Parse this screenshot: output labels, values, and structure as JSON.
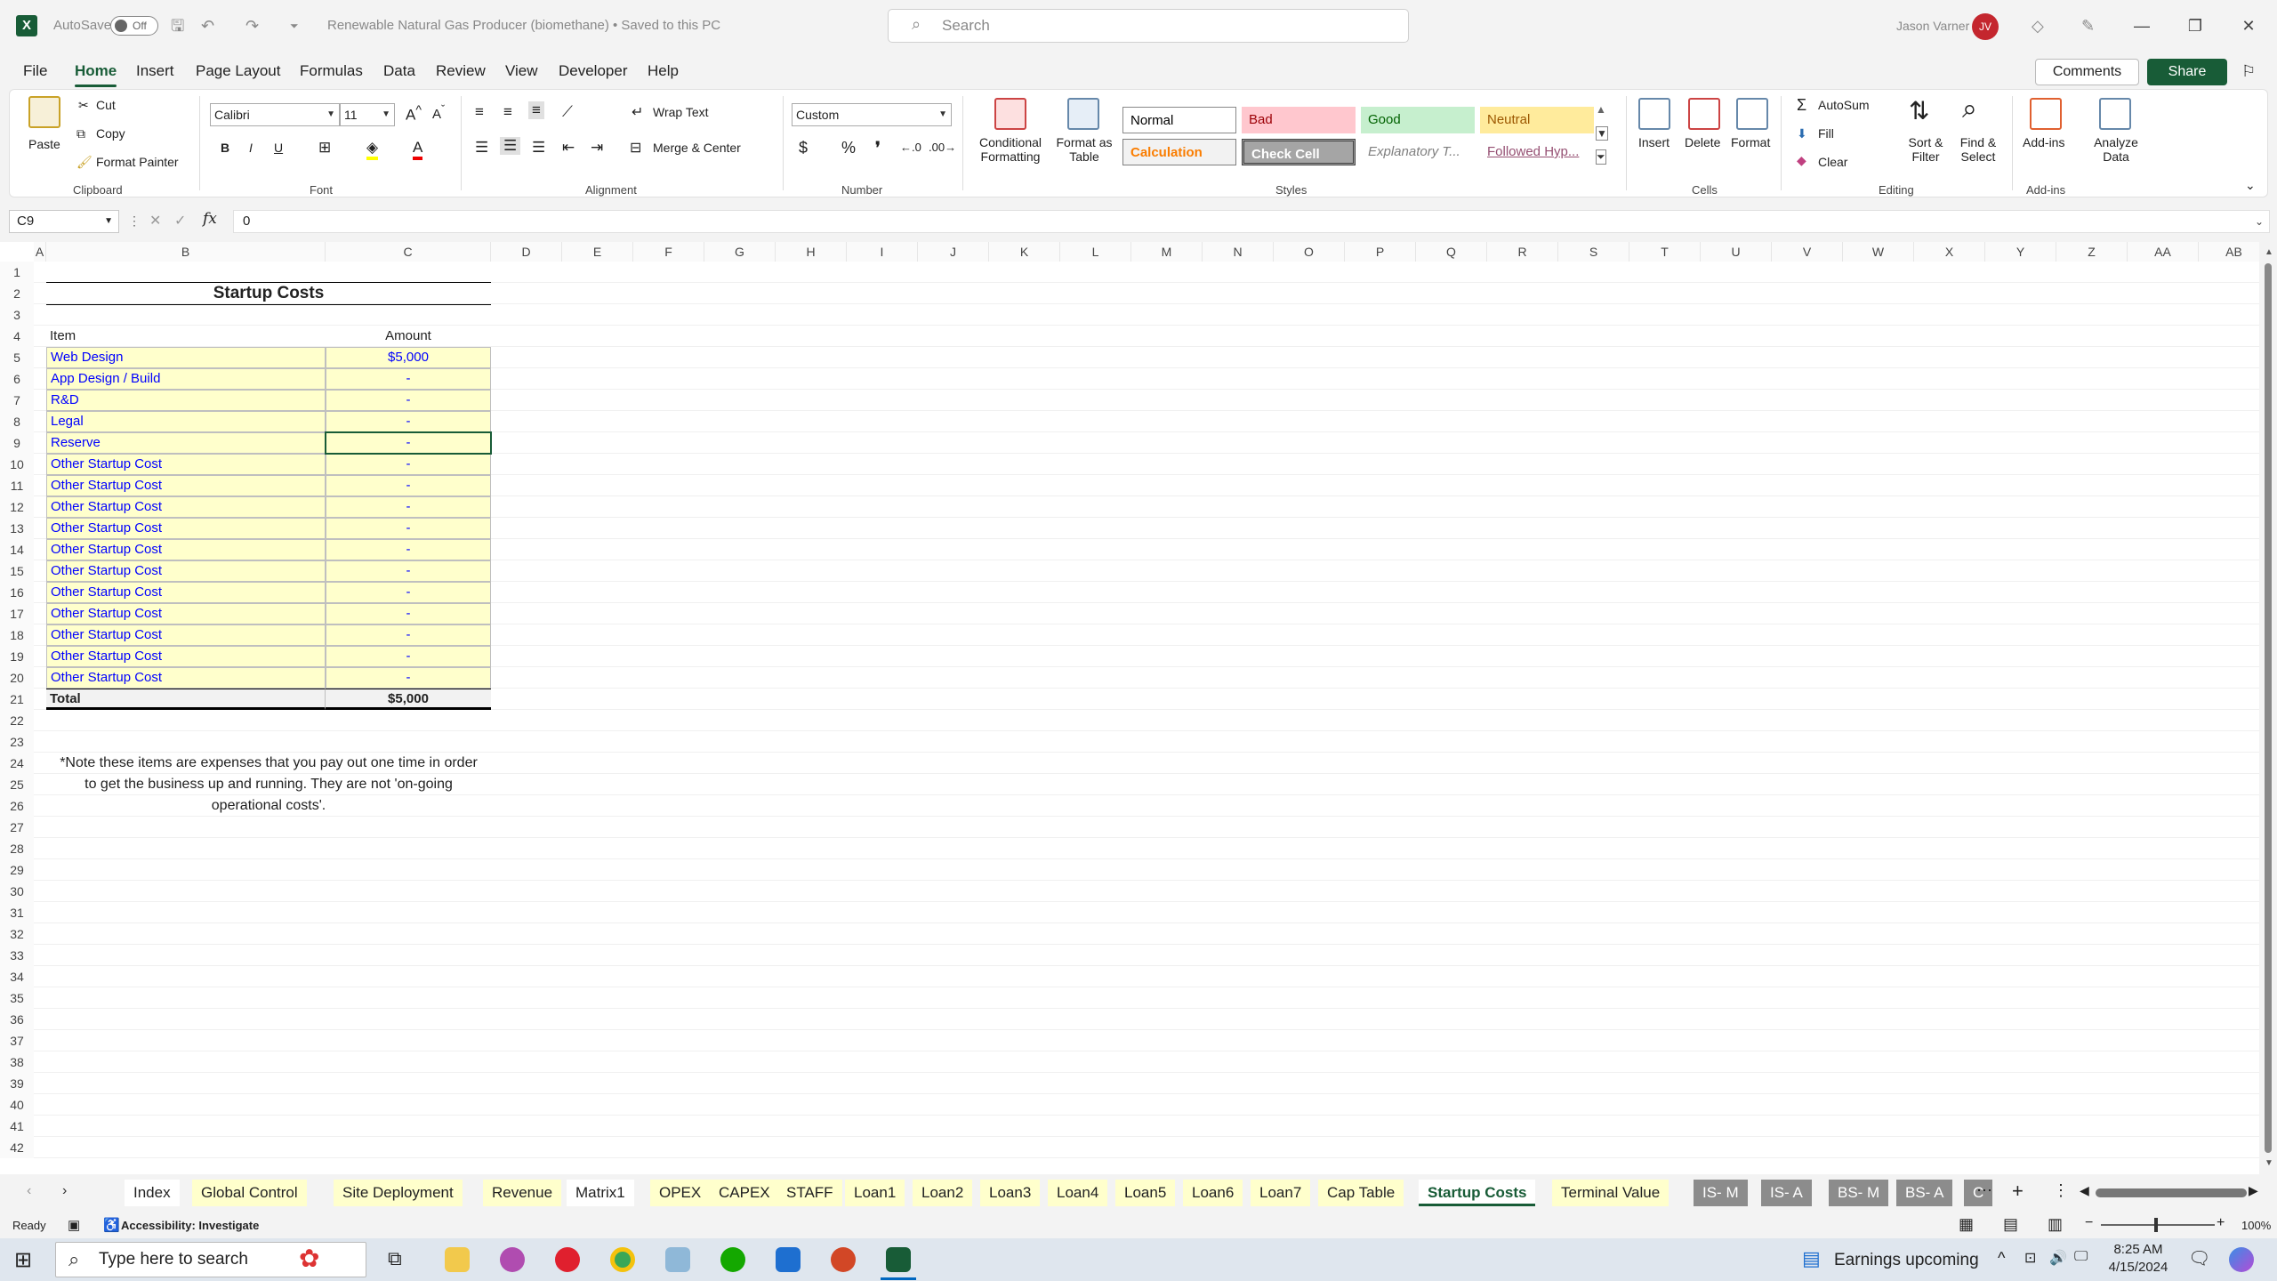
{
  "titlebar": {
    "autosave_label": "AutoSave",
    "autosave_state": "Off",
    "doc_title": "Renewable Natural Gas Producer (biomethane) • Saved to this PC",
    "search_placeholder": "Search",
    "user_name": "Jason Varner",
    "user_initials": "JV"
  },
  "menu": [
    "File",
    "Home",
    "Insert",
    "Page Layout",
    "Formulas",
    "Data",
    "Review",
    "View",
    "Developer",
    "Help"
  ],
  "menu_active": "Home",
  "menu_right": {
    "comments": "Comments",
    "share": "Share"
  },
  "ribbon": {
    "clipboard": {
      "paste": "Paste",
      "cut": "Cut",
      "copy": "Copy",
      "format_painter": "Format Painter",
      "group": "Clipboard"
    },
    "font": {
      "name": "Calibri",
      "size": "11",
      "bold": "B",
      "italic": "I",
      "underline": "U",
      "group": "Font"
    },
    "alignment": {
      "wrap_text": "Wrap Text",
      "merge_center": "Merge & Center",
      "group": "Alignment"
    },
    "number": {
      "format": "Custom",
      "currency": "$",
      "percent": "%",
      "group": "Number"
    },
    "styles": {
      "conditional": "Conditional Formatting",
      "format_table": "Format as Table",
      "normal": "Normal",
      "bad": "Bad",
      "good": "Good",
      "neutral": "Neutral",
      "calculation": "Calculation",
      "check_cell": "Check Cell",
      "explanatory": "Explanatory T...",
      "followed": "Followed Hyp...",
      "group": "Styles"
    },
    "cells": {
      "insert": "Insert",
      "delete": "Delete",
      "format": "Format",
      "group": "Cells"
    },
    "editing": {
      "autosum": "AutoSum",
      "fill": "Fill",
      "clear": "Clear",
      "sort_filter": "Sort & Filter",
      "find_select": "Find & Select",
      "group": "Editing"
    },
    "addins": {
      "addins": "Add-ins",
      "analyze": "Analyze Data",
      "group": "Add-ins"
    }
  },
  "formula_bar": {
    "name_box": "C9",
    "fx": "fx",
    "value": "0"
  },
  "columns": [
    "A",
    "B",
    "C",
    "D",
    "E",
    "F",
    "G",
    "H",
    "I",
    "J",
    "K",
    "L",
    "M",
    "N",
    "O",
    "P",
    "Q",
    "R",
    "S",
    "T",
    "U",
    "V",
    "W",
    "X",
    "Y",
    "Z",
    "AA",
    "AB"
  ],
  "rows": [
    "1",
    "2",
    "3",
    "4",
    "5",
    "6",
    "7",
    "8",
    "9",
    "10",
    "11",
    "12",
    "13",
    "14",
    "15",
    "16",
    "17",
    "18",
    "19",
    "20",
    "21",
    "22",
    "23",
    "24",
    "25",
    "26",
    "27",
    "28",
    "29",
    "30",
    "31",
    "32",
    "33",
    "34",
    "35",
    "36",
    "37",
    "38",
    "39",
    "40",
    "41",
    "42"
  ],
  "sheet": {
    "title": "Startup Costs",
    "header_item": "Item",
    "header_amount": "Amount",
    "items": [
      {
        "item": "Web Design",
        "amount": "$5,000"
      },
      {
        "item": "App Design / Build",
        "amount": "-"
      },
      {
        "item": "R&D",
        "amount": "-"
      },
      {
        "item": "Legal",
        "amount": "-"
      },
      {
        "item": "Reserve",
        "amount": "-"
      },
      {
        "item": "Other Startup Cost",
        "amount": "-"
      },
      {
        "item": "Other Startup Cost",
        "amount": "-"
      },
      {
        "item": "Other Startup Cost",
        "amount": "-"
      },
      {
        "item": "Other Startup Cost",
        "amount": "-"
      },
      {
        "item": "Other Startup Cost",
        "amount": "-"
      },
      {
        "item": "Other Startup Cost",
        "amount": "-"
      },
      {
        "item": "Other Startup Cost",
        "amount": "-"
      },
      {
        "item": "Other Startup Cost",
        "amount": "-"
      },
      {
        "item": "Other Startup Cost",
        "amount": "-"
      },
      {
        "item": "Other Startup Cost",
        "amount": "-"
      },
      {
        "item": "Other Startup Cost",
        "amount": "-"
      }
    ],
    "total_label": "Total",
    "total_amount": "$5,000",
    "note_line1": "*Note these items are expenses that you pay out one time in order",
    "note_line2": "to get the business up and running. They are not 'on-going",
    "note_line3": "operational costs'."
  },
  "tabs": [
    {
      "name": "Index",
      "style": "w"
    },
    {
      "name": "Global Control",
      "style": "y"
    },
    {
      "name": "Site Deployment",
      "style": "y"
    },
    {
      "name": "Revenue",
      "style": "y"
    },
    {
      "name": "Matrix1",
      "style": "w"
    },
    {
      "name": "OPEX",
      "style": "y"
    },
    {
      "name": "CAPEX",
      "style": "y"
    },
    {
      "name": "STAFF",
      "style": "y"
    },
    {
      "name": "Loan1",
      "style": "y"
    },
    {
      "name": "Loan2",
      "style": "y"
    },
    {
      "name": "Loan3",
      "style": "y"
    },
    {
      "name": "Loan4",
      "style": "y"
    },
    {
      "name": "Loan5",
      "style": "y"
    },
    {
      "name": "Loan6",
      "style": "y"
    },
    {
      "name": "Loan7",
      "style": "y"
    },
    {
      "name": "Cap Table",
      "style": "y"
    },
    {
      "name": "Startup Costs",
      "style": "active"
    },
    {
      "name": "Terminal Value",
      "style": "y"
    },
    {
      "name": "IS- M",
      "style": "g"
    },
    {
      "name": "IS- A",
      "style": "g"
    },
    {
      "name": "BS- M",
      "style": "g"
    },
    {
      "name": "BS- A",
      "style": "g"
    },
    {
      "name": "C",
      "style": "g"
    }
  ],
  "status": {
    "ready": "Ready",
    "accessibility": "Accessibility: Investigate",
    "zoom": "100%"
  },
  "taskbar": {
    "search_placeholder": "Type here to search",
    "news": "Earnings upcoming",
    "time": "8:25 AM",
    "date": "4/15/2024"
  },
  "colors": {
    "excel_green": "#185c37",
    "input_fill": "#ffffcc",
    "input_text": "#0000ff"
  }
}
